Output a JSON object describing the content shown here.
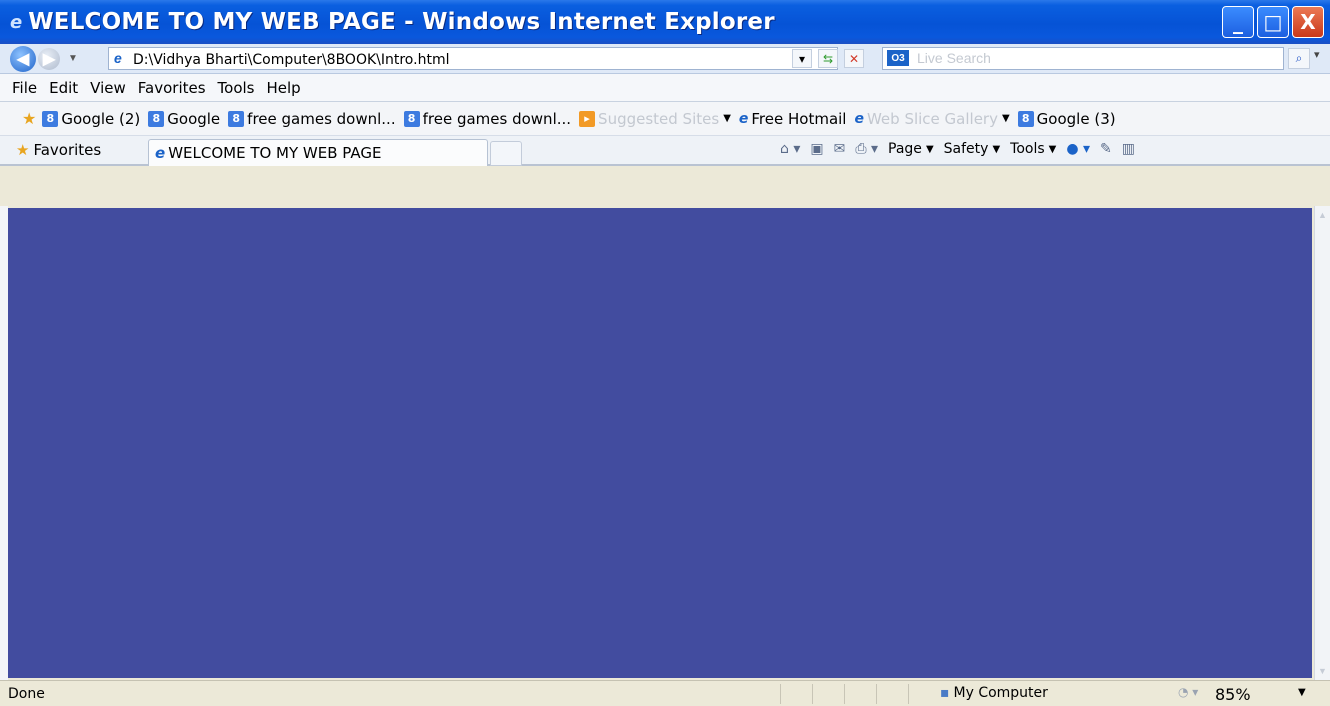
{
  "window": {
    "title": "WELCOME TO MY WEB PAGE - Windows Internet Explorer",
    "minimize_label": "_",
    "maximize_label": "□",
    "close_label": "X"
  },
  "address_bar": {
    "url": "D:\\Vidhya Bharti\\Computer\\8BOOK\\Intro.html",
    "search_placeholder": "Live Search",
    "search_logo": "O3"
  },
  "menu": {
    "items": [
      "File",
      "Edit",
      "View",
      "Favorites",
      "Tools",
      "Help"
    ]
  },
  "links_bar": {
    "items": [
      {
        "label": "Google (2)",
        "icon": "google-icon",
        "faded": false,
        "dropdown": false
      },
      {
        "label": "Google",
        "icon": "google-icon",
        "faded": false,
        "dropdown": false
      },
      {
        "label": "free games downl...",
        "icon": "google-icon",
        "faded": false,
        "dropdown": false
      },
      {
        "label": "free games downl...",
        "icon": "google-icon",
        "faded": false,
        "dropdown": false
      },
      {
        "label": "Suggested Sites",
        "icon": "suggested-sites-icon",
        "faded": true,
        "dropdown": true
      },
      {
        "label": "Free Hotmail",
        "icon": "ie-icon",
        "faded": false,
        "dropdown": false
      },
      {
        "label": "Web Slice Gallery",
        "icon": "ie-icon",
        "faded": true,
        "dropdown": true
      },
      {
        "label": "Google (3)",
        "icon": "google-icon",
        "faded": false,
        "dropdown": false
      }
    ]
  },
  "tab_row": {
    "favorites_label": "Favorites",
    "active_tab_title": "WELCOME TO MY WEB PAGE",
    "commands": {
      "page": "Page",
      "safety": "Safety",
      "tools": "Tools"
    }
  },
  "page": {
    "background_color": "#424c9f"
  },
  "status_bar": {
    "status": "Done",
    "zone": "My Computer",
    "zoom": "85%"
  },
  "colors": {
    "title_bar": "#0653d6",
    "close_button": "#c9381a",
    "page_background": "#424c9f"
  }
}
